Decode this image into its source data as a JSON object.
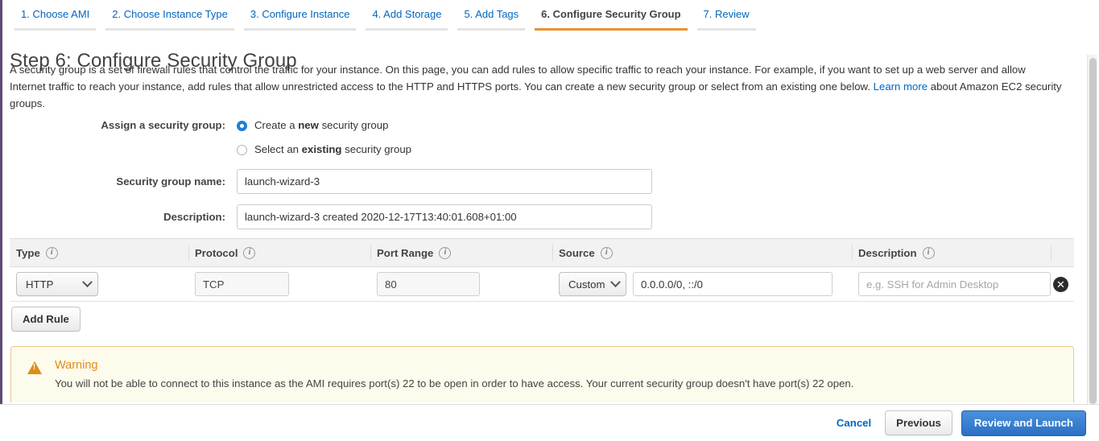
{
  "wizard": {
    "tabs": [
      {
        "label": "1. Choose AMI",
        "active": false
      },
      {
        "label": "2. Choose Instance Type",
        "active": false
      },
      {
        "label": "3. Configure Instance",
        "active": false
      },
      {
        "label": "4. Add Storage",
        "active": false
      },
      {
        "label": "5. Add Tags",
        "active": false
      },
      {
        "label": "6. Configure Security Group",
        "active": true
      },
      {
        "label": "7. Review",
        "active": false
      }
    ]
  },
  "page": {
    "title": "Step 6: Configure Security Group",
    "intro_part1": "A security group is a set of firewall rules that control the traffic for your instance. On this page, you can add rules to allow specific traffic to reach your instance. For example, if you want to set up a web server and allow Internet traffic to reach your instance, add rules that allow unrestricted access to the HTTP and HTTPS ports. You can create a new security group or select from an existing one below. ",
    "learn_more": "Learn more",
    "intro_part2": " about Amazon EC2 security groups."
  },
  "assign": {
    "label": "Assign a security group:",
    "option_new_prefix": "Create a ",
    "option_new_bold": "new",
    "option_new_suffix": " security group",
    "option_existing_prefix": "Select an ",
    "option_existing_bold": "existing",
    "option_existing_suffix": " security group",
    "selected": "new"
  },
  "fields": {
    "name_label": "Security group name:",
    "name_value": "launch-wizard-3",
    "description_label": "Description:",
    "description_value": "launch-wizard-3 created 2020-12-17T13:40:01.608+01:00"
  },
  "rules_table": {
    "columns": [
      {
        "label": "Type",
        "info": "info-icon"
      },
      {
        "label": "Protocol",
        "info": "info-icon"
      },
      {
        "label": "Port Range",
        "info": "info-icon"
      },
      {
        "label": "Source",
        "info": "info-icon"
      },
      {
        "label": "Description",
        "info": "info-icon"
      }
    ],
    "rows": [
      {
        "type": "HTTP",
        "protocol": "TCP",
        "port_range": "80",
        "source_mode": "Custom",
        "source_value": "0.0.0.0/0, ::/0",
        "description_value": "",
        "description_placeholder": "e.g. SSH for Admin Desktop",
        "delete_glyph": "✕"
      }
    ],
    "add_rule_label": "Add Rule"
  },
  "warning": {
    "title": "Warning",
    "text": "You will not be able to connect to this instance as the AMI requires port(s) 22 to be open in order to have access. Your current security group doesn't have port(s) 22 open."
  },
  "footer": {
    "cancel": "Cancel",
    "previous": "Previous",
    "review_and_launch": "Review and Launch"
  },
  "colors": {
    "accent_orange": "#ec912d",
    "link_blue": "#0066c0",
    "primary_button": "#2b6fc4",
    "warning_border": "#e8c98a",
    "warning_bg": "#fdfbeb",
    "radio_selected": "#1f7fd6"
  }
}
